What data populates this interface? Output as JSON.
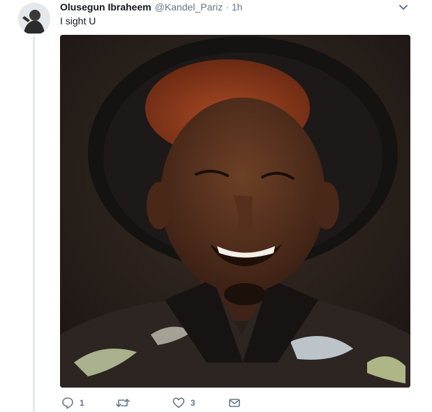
{
  "tweet": {
    "display_name": "Olusegun Ibraheem",
    "handle": "@Kandel_Pariz",
    "separator": "·",
    "time": "1h",
    "text": "I sight U",
    "media_alt": "Portrait of a smiling man in a wide black hat and patterned shirt"
  },
  "actions": {
    "reply_count": "1",
    "retweet_count": "",
    "like_count": "3"
  },
  "colors": {
    "text_primary": "#14171a",
    "text_secondary": "#657786",
    "thread_line": "#e1e8ed"
  },
  "icons": [
    "caret-down-icon",
    "reply-icon",
    "retweet-icon",
    "like-icon",
    "direct-message-icon"
  ]
}
